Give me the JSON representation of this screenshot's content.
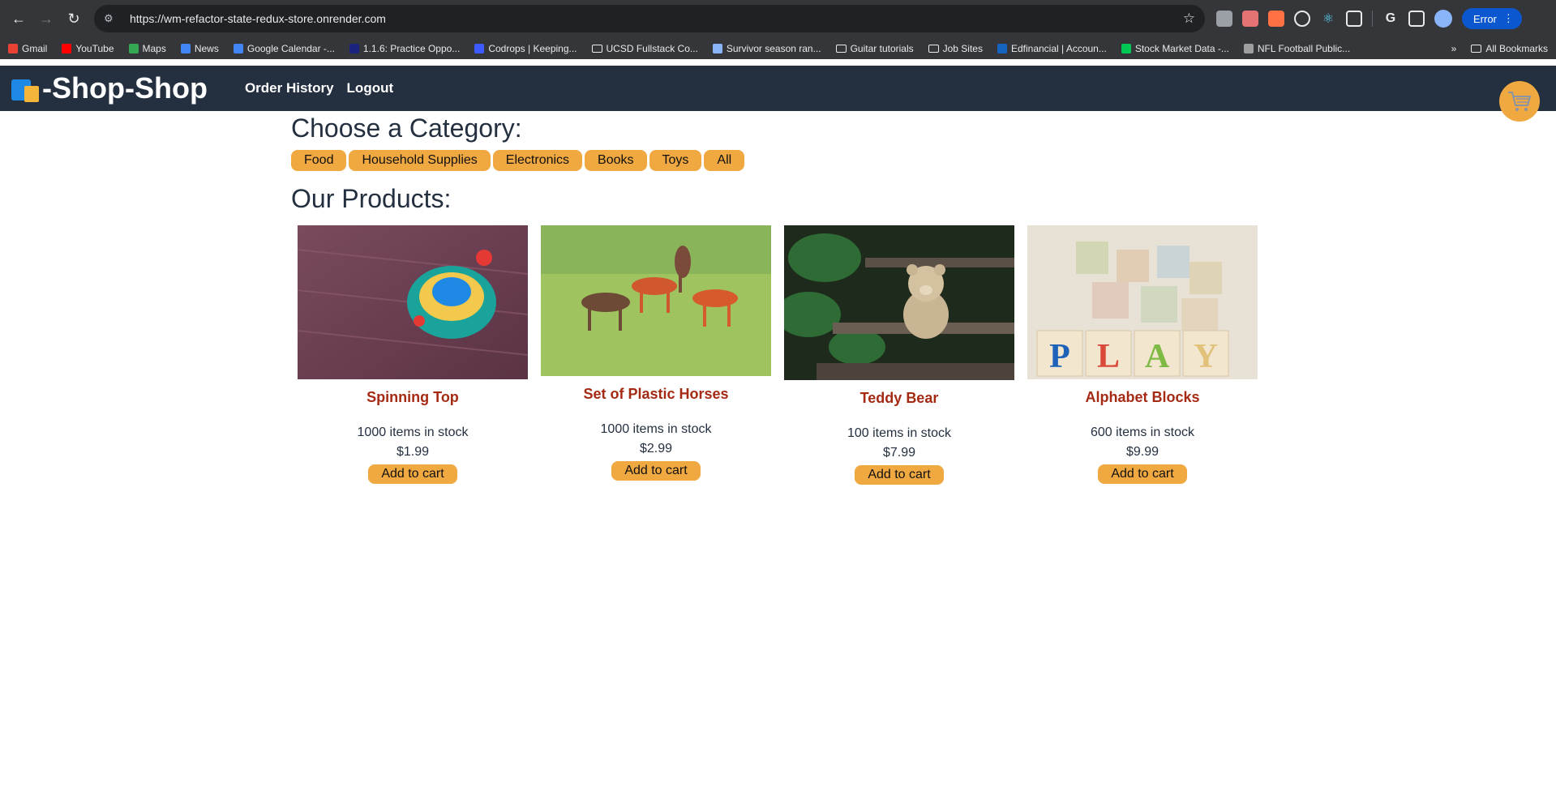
{
  "browser": {
    "url": "https://wm-refactor-state-redux-store.onrender.com",
    "profile_status": "Error",
    "bookmarks": [
      {
        "label": "Gmail",
        "color": "#ea4335"
      },
      {
        "label": "YouTube",
        "color": "#ff0000"
      },
      {
        "label": "Maps",
        "color": "#34a853"
      },
      {
        "label": "News",
        "color": "#4285f4"
      },
      {
        "label": "Google Calendar -...",
        "color": "#4285f4"
      },
      {
        "label": "1.1.6: Practice Oppo...",
        "color": "#1a237e"
      },
      {
        "label": "Codrops | Keeping...",
        "color": "#3d5afe"
      },
      {
        "label": "UCSD Fullstack Co...",
        "color": "folder"
      },
      {
        "label": "Survivor season ran...",
        "color": "#8ab4f8"
      },
      {
        "label": "Guitar tutorials",
        "color": "folder"
      },
      {
        "label": "Job Sites",
        "color": "folder"
      },
      {
        "label": "Edfinancial | Accoun...",
        "color": "#1565c0"
      },
      {
        "label": "Stock Market Data -...",
        "color": "#00c853"
      },
      {
        "label": "NFL Football Public...",
        "color": "#9e9e9e"
      }
    ],
    "all_bookmarks": "All Bookmarks"
  },
  "header": {
    "title": "-Shop-Shop",
    "nav": [
      "Order History",
      "Logout"
    ]
  },
  "categories": {
    "title": "Choose a Category:",
    "items": [
      "Food",
      "Household Supplies",
      "Electronics",
      "Books",
      "Toys",
      "All"
    ]
  },
  "products": {
    "title": "Our Products:",
    "items": [
      {
        "name": "Spinning Top",
        "stock": "1000 items in stock",
        "price": "$1.99",
        "button": "Add to cart"
      },
      {
        "name": "Set of Plastic Horses",
        "stock": "1000 items in stock",
        "price": "$2.99",
        "button": "Add to cart"
      },
      {
        "name": "Teddy Bear",
        "stock": "100 items in stock",
        "price": "$7.99",
        "button": "Add to cart"
      },
      {
        "name": "Alphabet Blocks",
        "stock": "600 items in stock",
        "price": "$9.99",
        "button": "Add to cart"
      }
    ]
  },
  "colors": {
    "header_bg": "#243040",
    "accent": "#f0a841",
    "product_name": "#a52a14"
  }
}
